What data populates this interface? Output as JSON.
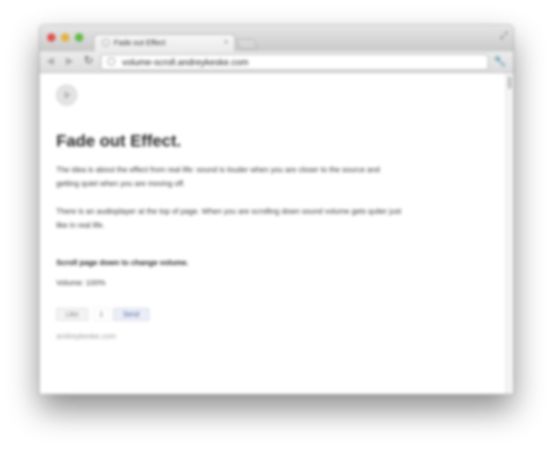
{
  "browser": {
    "tab": {
      "title": "Fade out Effect",
      "close": "×"
    },
    "omnibox": {
      "url": "volume-scroll.andreykeske.com"
    },
    "icons": {
      "back": "back-arrow-icon",
      "forward": "forward-arrow-icon",
      "reload": "reload-icon",
      "wrench": "wrench-icon",
      "fullscreen": "fullscreen-icon"
    },
    "colors": {
      "close": "#e0524c",
      "minimize": "#e3b23c",
      "maximize": "#5fba46"
    }
  },
  "page": {
    "title": "Fade out Effect.",
    "paragraph1": "The idea is about the effect from real life: sound is louder when you are closer to the source and getting quiet when you are moving off.",
    "paragraph2": "There is an audioplayer at the top of page. When you are scrolling down sound volume gets quiter just like in real life.",
    "instruction": "Scroll page down to change volume.",
    "volume": "Volume: 100%",
    "social": {
      "like_label": "Like",
      "like_count": "1",
      "send_label": "Send"
    },
    "footer_link": "andreykeske.com"
  }
}
